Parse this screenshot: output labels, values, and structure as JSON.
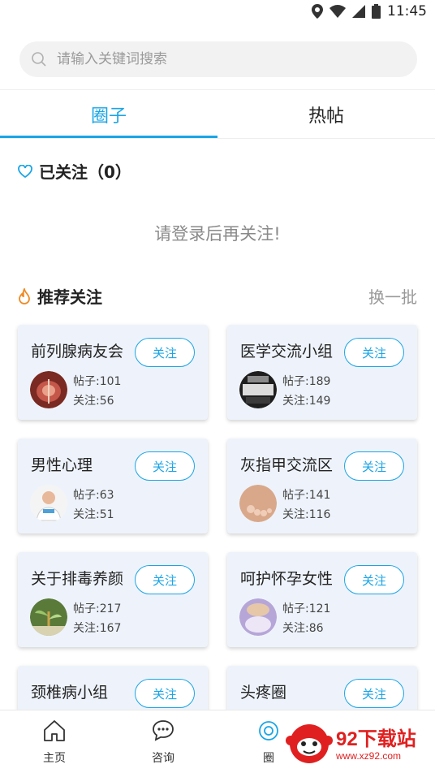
{
  "status": {
    "time": "11:45"
  },
  "search": {
    "placeholder": "请输入关键词搜索"
  },
  "tabs": [
    {
      "label": "圈子",
      "active": true
    },
    {
      "label": "热帖",
      "active": false
    }
  ],
  "followed": {
    "title": "已关注（0）",
    "empty_hint": "请登录后再关注!"
  },
  "recommend": {
    "title": "推荐关注",
    "swap_label": "换一批"
  },
  "follow_label": "关注",
  "cards": [
    {
      "name": "前列腺病友会",
      "posts": "帖子:101",
      "followers": "关注:56",
      "avatar": "prostate-image"
    },
    {
      "name": "医学交流小组",
      "posts": "帖子:189",
      "followers": "关注:149",
      "avatar": "medical-image"
    },
    {
      "name": "男性心理",
      "posts": "帖子:63",
      "followers": "关注:51",
      "avatar": "doctor-image"
    },
    {
      "name": "灰指甲交流区",
      "posts": "帖子:141",
      "followers": "关注:116",
      "avatar": "foot-image"
    },
    {
      "name": "关于排毒养颜",
      "posts": "帖子:217",
      "followers": "关注:167",
      "avatar": "plant-image"
    },
    {
      "name": "呵护怀孕女性",
      "posts": "帖子:121",
      "followers": "关注:86",
      "avatar": "pregnancy-image"
    },
    {
      "name": "颈椎病小组",
      "posts": "",
      "followers": "",
      "avatar": ""
    },
    {
      "name": "头疼圈",
      "posts": "",
      "followers": "",
      "avatar": ""
    }
  ],
  "nav": [
    {
      "label": "主页",
      "icon": "home-icon"
    },
    {
      "label": "咨询",
      "icon": "chat-icon"
    },
    {
      "label": "圈",
      "icon": "circle-icon"
    }
  ],
  "watermark": {
    "text": "92下载站",
    "url": "www.xz92.com"
  },
  "colors": {
    "accent": "#1aa5e6",
    "card_bg": "#eef3fb",
    "fire": "#f08a24"
  }
}
